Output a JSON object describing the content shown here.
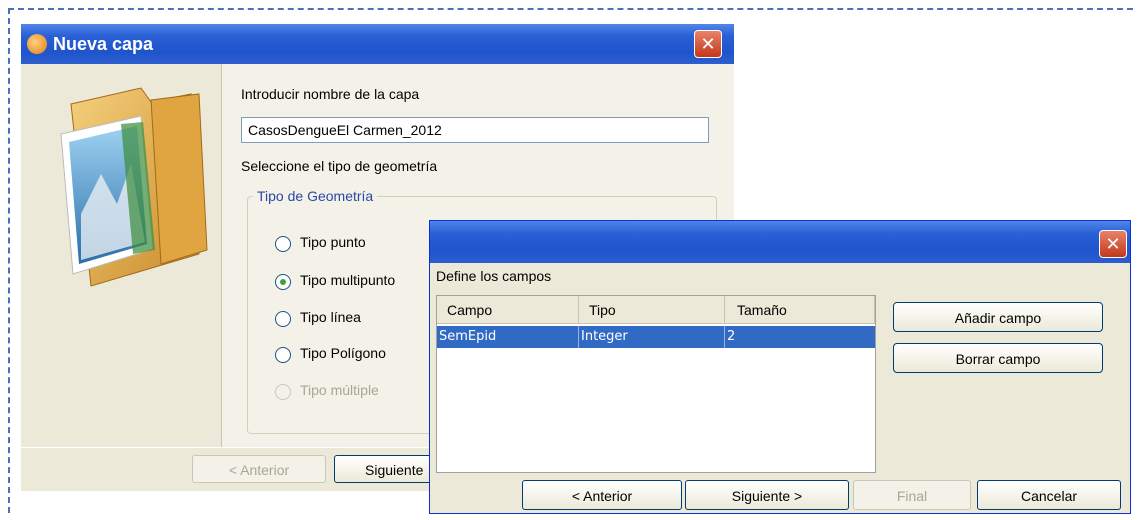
{
  "dialog1": {
    "title": "Nueva capa",
    "name_label": "Introducir nombre de la capa",
    "name_value": "CasosDengueEl Carmen_2012",
    "geometry_label": "Seleccione el tipo de geometría",
    "group_title": "Tipo de Geometría",
    "options": [
      "Tipo punto",
      "Tipo multipunto",
      "Tipo línea",
      "Tipo Polígono",
      "Tipo múltiple"
    ],
    "selected_option": "Tipo multipunto",
    "back_button": "< Anterior",
    "next_button": "Siguiente"
  },
  "dialog2": {
    "fields_label": "Define los campos",
    "columns": [
      "Campo",
      "Tipo",
      "Tamaño"
    ],
    "rows": [
      [
        "SemEpid",
        "Integer",
        "2"
      ]
    ],
    "add_button": "Añadir campo",
    "delete_button": "Borrar campo",
    "back_button": "< Anterior",
    "next_button": "Siguiente >",
    "finish_button": "Final",
    "cancel_button": "Cancelar"
  },
  "colors": {
    "titlebar": "#2a5fd6",
    "selection": "#316ac5",
    "frame": "#4a73b5"
  },
  "icons": [
    "app-icon",
    "close-icon",
    "folder-image-icon"
  ]
}
